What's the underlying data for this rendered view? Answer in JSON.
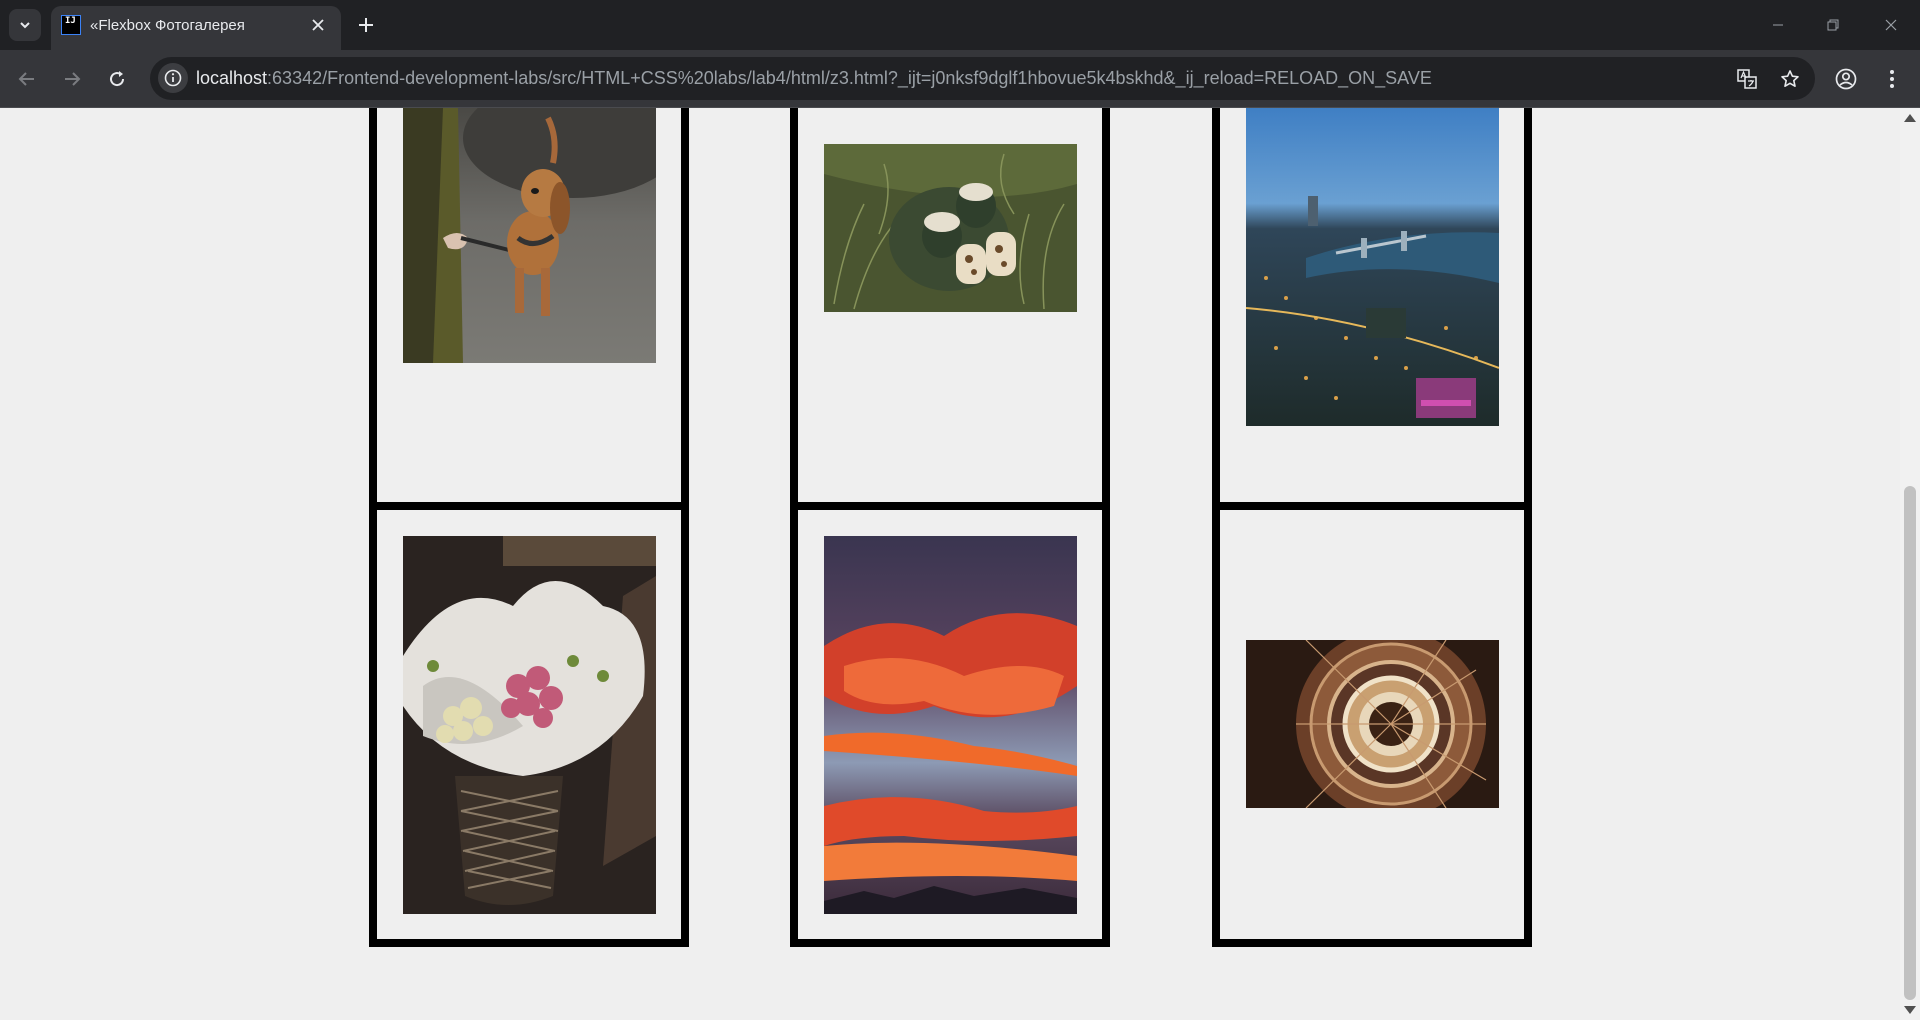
{
  "browser": {
    "tab_title": "«Flexbox Фотогалерея",
    "favicon_text": "IJ",
    "url_host": "localhost",
    "url_rest": ":63342/Frontend-development-labs/src/HTML+CSS%20labs/lab4/html/z3.html?_ijt=j0nksf9dglf1hbovue5k4bskhd&_ij_reload=RELOAD_ON_SAVE",
    "icons": {
      "tab_search": "chevron-down-icon",
      "close": "close-icon",
      "new_tab": "plus-icon",
      "back": "back-arrow-icon",
      "forward": "forward-arrow-icon",
      "reload": "reload-icon",
      "site_info": "site-info-icon",
      "translate": "translate-icon",
      "bookmark": "star-icon",
      "profile": "profile-icon",
      "menu": "kebab-menu-icon"
    }
  },
  "gallery": {
    "photos": [
      {
        "subject": "dachshund on leash",
        "colors": [
          "#6a6a66",
          "#b5773f",
          "#3f3f33"
        ]
      },
      {
        "subject": "two mugs and sandwiches on grass",
        "colors": [
          "#4c5a2f",
          "#dfd9c8",
          "#2f3b27"
        ]
      },
      {
        "subject": "city at night with bridge",
        "colors": [
          "#4e8ecf",
          "#2c4a5e",
          "#d7a24a"
        ]
      },
      {
        "subject": "bouquets of roses in basket",
        "colors": [
          "#2b2420",
          "#e6e3df",
          "#c55a7a"
        ]
      },
      {
        "subject": "red sunset clouds",
        "colors": [
          "#463f5c",
          "#e24b2a",
          "#8c9bb5"
        ]
      },
      {
        "subject": "spiral staircase from above",
        "colors": [
          "#2a1a12",
          "#c08f66",
          "#e9d9c0"
        ]
      }
    ]
  }
}
